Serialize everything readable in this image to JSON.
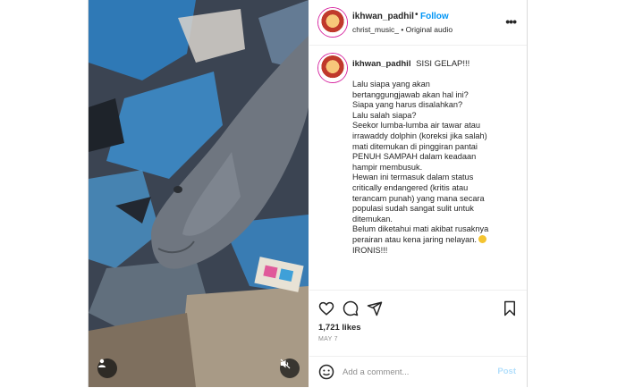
{
  "post": {
    "username": "ikhwan_padhil",
    "follow_label": "Follow",
    "audio_line": "christ_music_ • Original audio",
    "caption_title": "SISI GELAP!!!",
    "caption_lines": [
      "Lalu siapa yang akan",
      "bertanggungjawab akan hal ini?",
      "Siapa yang harus disalahkan?",
      "Lalu salah siapa?",
      "Seekor lumba-lumba air tawar atau",
      "irrawaddy dolphin (koreksi jika salah)",
      "mati ditemukan di pinggiran pantai",
      "PENUH SAMPAH dalam keadaan",
      "hampir membusuk.",
      "Hewan ini termasuk dalam status",
      "critically endangered (kritis atau",
      "terancam punah) yang mana secara",
      "populasi sudah sangat sulit untuk",
      "ditemukan.",
      "Belum diketahui mati akibat rusaknya",
      "perairan atau kena jaring nelayan.",
      "IRONIS!!!"
    ],
    "likes": "1,721 likes",
    "date": "MAY 7"
  },
  "comment": {
    "placeholder": "Add a comment...",
    "post_label": "Post"
  },
  "icons": {
    "more": "more-options-icon",
    "like": "heart-icon",
    "comment": "comment-icon",
    "share": "share-icon",
    "save": "bookmark-icon",
    "emoji": "emoji-icon",
    "user": "user-tag-icon",
    "mute": "muted-speaker-icon"
  },
  "colors": {
    "accent": "#0095f6",
    "post_disabled": "#b2dffc"
  }
}
